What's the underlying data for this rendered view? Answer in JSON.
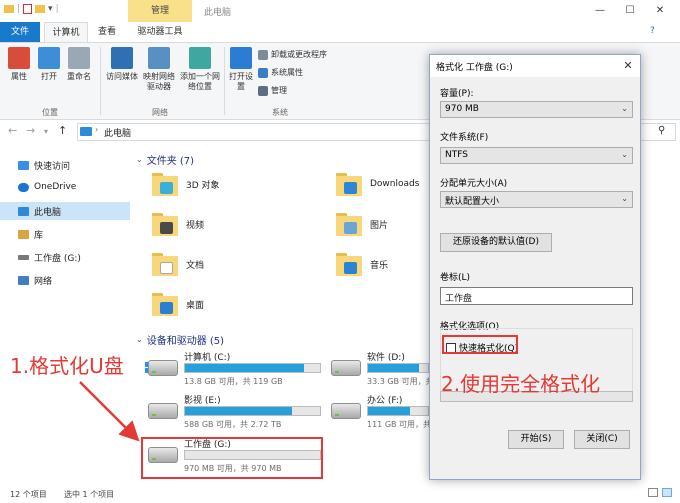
{
  "window": {
    "context_tab": "管理",
    "title": "此电脑"
  },
  "tabs": [
    "文件",
    "计算机",
    "查看",
    "驱动器工具"
  ],
  "ribbon": {
    "location_buttons": [
      "属性",
      "打开",
      "重命名"
    ],
    "location_group": "位置",
    "network_buttons": [
      "访问媒体",
      "映射网络驱动器",
      "添加一个网络位置"
    ],
    "network_group": "网络",
    "system_open": "打开设置",
    "system_items": [
      "卸载或更改程序",
      "系统属性",
      "管理"
    ],
    "system_group": "系统"
  },
  "address": {
    "path": "此电脑"
  },
  "nav": {
    "items": [
      "快速访问",
      "OneDrive",
      "此电脑",
      "库",
      "工作盘 (G:)",
      "网络"
    ]
  },
  "content": {
    "folders_header": "文件夹 (7)",
    "folders": [
      "3D 对象",
      "Downloads",
      "视频",
      "图片",
      "文档",
      "音乐",
      "桌面"
    ],
    "drives_header": "设备和驱动器 (5)",
    "drives": [
      {
        "name": "计算机 (C:)",
        "size": "13.8 GB 可用，共 119 GB",
        "used_fraction": 0.88
      },
      {
        "name": "软件 (D:)",
        "size": "33.3 GB 可用，共 ...",
        "used_fraction": 0.85
      },
      {
        "name": "影视 (E:)",
        "size": "588 GB 可用，共 2.72 TB",
        "used_fraction": 0.79
      },
      {
        "name": "办公 (F:)",
        "size": "111 GB 可用，共 ...",
        "used_fraction": 0.7
      },
      {
        "name": "工作盘 (G:)",
        "size": "970 MB 可用，共 970 MB",
        "used_fraction": 0.0
      }
    ]
  },
  "status": {
    "items": "12 个项目",
    "selected": "选中 1 个项目"
  },
  "dialog": {
    "title": "格式化 工作盘 (G:)",
    "capacity_label": "容量(P):",
    "capacity_value": "970 MB",
    "fs_label": "文件系统(F)",
    "fs_value": "NTFS",
    "alloc_label": "分配单元大小(A)",
    "alloc_value": "默认配置大小",
    "restore_button": "还原设备的默认值(D)",
    "volume_label": "卷标(L)",
    "volume_value": "工作盘",
    "options_label": "格式化选项(O)",
    "quick_format": "快速格式化(Q)",
    "quick_format_checked": false,
    "start_button": "开始(S)",
    "close_button": "关闭(C)"
  },
  "annotations": {
    "step1": "1.格式化U盘",
    "step2": "2.使用完全格式化",
    "color": "#e53935"
  }
}
